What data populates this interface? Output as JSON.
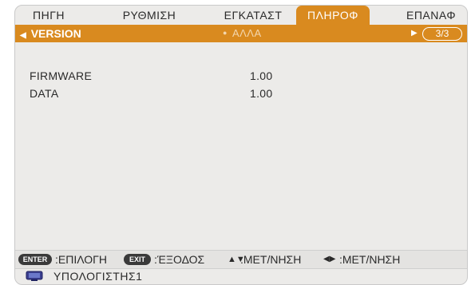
{
  "tabs": [
    "ΠΗΓΗ",
    "ΡΥΘΜΙΣΗ",
    "ΕΓΚΑΤΑΣΤ",
    "ΠΛΗΡΟΦ",
    "ΕΠΑΝΑΦ"
  ],
  "active_tab": "ΠΛΗΡΟΦ",
  "subbar": {
    "selected": "VERSION",
    "other": "ΑΛΛΑ",
    "page": "3/3"
  },
  "rows": [
    {
      "label": "FIRMWARE",
      "value": "1.00"
    },
    {
      "label": "DATA",
      "value": "1.00"
    }
  ],
  "help": {
    "enter_key": "ENTER",
    "enter_text": ":ΕΠΙΛΟΓΗ",
    "exit_key": "EXIT",
    "exit_text": ":ΈΞΟΔΟΣ",
    "updown_text": ":ΜΕΤ/ΝΗΣΗ",
    "leftright_text": ":ΜΕΤ/ΝΗΣΗ"
  },
  "source": {
    "name": "ΥΠΟΛΟΓΙΣΤΗΣ1",
    "icon": "computer-monitor-icon"
  },
  "colors": {
    "accent": "#d98a1f",
    "background": "#ecebe9"
  }
}
